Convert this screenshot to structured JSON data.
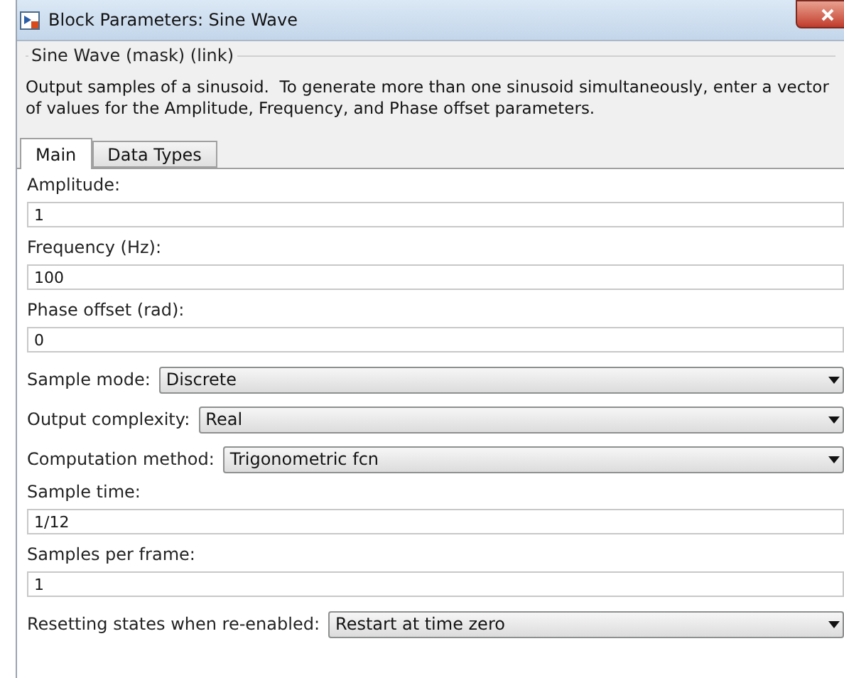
{
  "window": {
    "title": "Block Parameters: Sine Wave"
  },
  "group": {
    "title": "Sine Wave (mask) (link)",
    "description": "Output samples of a sinusoid.  To generate more than one sinusoid simultaneously, enter a vector of values for the Amplitude, Frequency, and Phase offset parameters."
  },
  "tabs": [
    {
      "label": "Main",
      "selected": true
    },
    {
      "label": "Data Types",
      "selected": false
    }
  ],
  "parameters": [
    {
      "kind": "text",
      "label": "Amplitude:",
      "value": "1"
    },
    {
      "kind": "text",
      "label": "Frequency (Hz):",
      "value": "100"
    },
    {
      "kind": "text",
      "label": "Phase offset (rad):",
      "value": "0"
    },
    {
      "kind": "dropdown",
      "label": "Sample mode:",
      "value": "Discrete"
    },
    {
      "kind": "dropdown",
      "label": "Output complexity:",
      "value": "Real"
    },
    {
      "kind": "dropdown",
      "label": "Computation method:",
      "value": "Trigonometric fcn"
    },
    {
      "kind": "text",
      "label": "Sample time:",
      "value": "1/12"
    },
    {
      "kind": "text",
      "label": "Samples per frame:",
      "value": "1"
    },
    {
      "kind": "dropdown",
      "label": "Resetting states when re-enabled:",
      "value": "Restart at time zero"
    }
  ]
}
